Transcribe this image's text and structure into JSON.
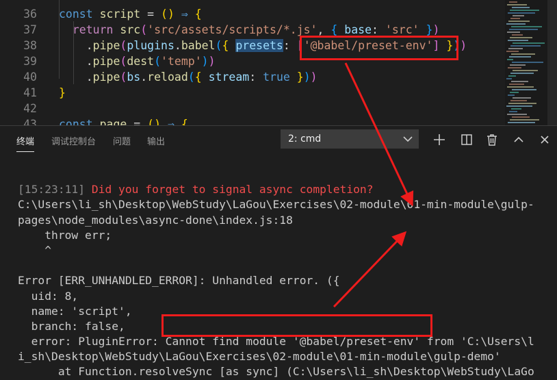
{
  "editor": {
    "lines": [
      {
        "num": "36",
        "tokens": [
          [
            "k-blue",
            "const"
          ],
          [
            "",
            " "
          ],
          [
            "k-fn",
            "script"
          ],
          [
            "",
            " = "
          ],
          [
            "k-gold",
            "()"
          ],
          [
            "",
            " "
          ],
          [
            "k-blue",
            "⇒"
          ],
          [
            "",
            " "
          ],
          [
            "k-gold",
            "{"
          ]
        ]
      },
      {
        "num": "37",
        "tokens": [
          [
            "",
            "  "
          ],
          [
            "k-purple",
            "return"
          ],
          [
            "",
            " "
          ],
          [
            "k-fn",
            "src"
          ],
          [
            "k-pink",
            "("
          ],
          [
            "k-str",
            "'src/assets/scripts/*.js'"
          ],
          [
            "",
            ", "
          ],
          [
            "k-sky",
            "{"
          ],
          [
            "",
            " "
          ],
          [
            "k-var",
            "base"
          ],
          [
            "",
            ": "
          ],
          [
            "k-str",
            "'src'"
          ],
          [
            "",
            " "
          ],
          [
            "k-sky",
            "}"
          ],
          [
            "k-pink",
            ")"
          ]
        ]
      },
      {
        "num": "38",
        "tokens": [
          [
            "",
            "    ."
          ],
          [
            "k-fn",
            "pipe"
          ],
          [
            "k-pink",
            "("
          ],
          [
            "k-var",
            "plugins"
          ],
          [
            "",
            "."
          ],
          [
            "k-fn",
            "babel"
          ],
          [
            "k-sky",
            "("
          ],
          [
            "k-gold",
            "{"
          ],
          [
            "",
            " "
          ],
          [
            "k-var hl",
            "presets"
          ],
          [
            "",
            ": "
          ],
          [
            "k-pink",
            "["
          ],
          [
            "k-str",
            "'@babel/preset-env'"
          ],
          [
            "k-pink",
            "]"
          ],
          [
            "",
            " "
          ],
          [
            "k-gold",
            "}"
          ],
          [
            "k-sky",
            ")"
          ],
          [
            "k-pink",
            ")"
          ]
        ]
      },
      {
        "num": "39",
        "tokens": [
          [
            "",
            "    ."
          ],
          [
            "k-fn",
            "pipe"
          ],
          [
            "k-pink",
            "("
          ],
          [
            "k-fn",
            "dest"
          ],
          [
            "k-sky",
            "("
          ],
          [
            "k-str",
            "'temp'"
          ],
          [
            "k-sky",
            ")"
          ],
          [
            "k-pink",
            ")"
          ]
        ]
      },
      {
        "num": "40",
        "tokens": [
          [
            "",
            "    ."
          ],
          [
            "k-fn",
            "pipe"
          ],
          [
            "k-pink",
            "("
          ],
          [
            "k-var",
            "bs"
          ],
          [
            "",
            "."
          ],
          [
            "k-fn",
            "reload"
          ],
          [
            "k-sky",
            "("
          ],
          [
            "k-gold",
            "{"
          ],
          [
            "",
            " "
          ],
          [
            "k-var",
            "stream"
          ],
          [
            "",
            ": "
          ],
          [
            "k-blue",
            "true"
          ],
          [
            "",
            " "
          ],
          [
            "k-gold",
            "}"
          ],
          [
            "k-sky",
            ")"
          ],
          [
            "k-pink",
            ")"
          ]
        ]
      },
      {
        "num": "41",
        "tokens": [
          [
            "k-gold",
            "}"
          ]
        ]
      },
      {
        "num": "42",
        "tokens": []
      },
      {
        "num": "43",
        "tokens": [
          [
            "k-blue",
            "const"
          ],
          [
            "",
            " "
          ],
          [
            "k-fn",
            "page"
          ],
          [
            "",
            " = "
          ],
          [
            "k-gold",
            "()"
          ],
          [
            "",
            " "
          ],
          [
            "k-blue",
            "⇒"
          ],
          [
            "",
            " "
          ],
          [
            "k-gold",
            "{"
          ]
        ]
      }
    ]
  },
  "panel": {
    "tabs": [
      "终端",
      "调试控制台",
      "问题",
      "输出"
    ],
    "active_tab": 0,
    "terminal_select": "2: cmd",
    "terminal_lines": [
      [
        [
          "",
          " "
        ]
      ],
      [
        [
          "gray",
          "[15:23:11]"
        ],
        [
          "",
          " "
        ],
        [
          "red",
          "Did you forget to signal async completion?"
        ]
      ],
      [
        [
          "",
          "C:\\Users\\li_sh\\Desktop\\WebStudy\\LaGou\\Exercises\\02-module\\01-min-module\\gulp-"
        ]
      ],
      [
        [
          "",
          "pages\\node_modules\\async-done\\index.js:18"
        ]
      ],
      [
        [
          "",
          "    throw err;"
        ]
      ],
      [
        [
          "",
          "    ^"
        ]
      ],
      [
        [
          "",
          " "
        ]
      ],
      [
        [
          "",
          "Error [ERR_UNHANDLED_ERROR]: Unhandled error. ({"
        ]
      ],
      [
        [
          "",
          "  uid: 8,"
        ]
      ],
      [
        [
          "",
          "  name: 'script',"
        ]
      ],
      [
        [
          "",
          "  branch: false,"
        ]
      ],
      [
        [
          "",
          "  error: PluginError: Cannot find module '@babel/preset-env' from 'C:\\Users\\l"
        ]
      ],
      [
        [
          "",
          "i_sh\\Desktop\\WebStudy\\LaGou\\Exercises\\02-module\\01-min-module\\gulp-demo'"
        ]
      ],
      [
        [
          "",
          "      at Function.resolveSync [as sync] (C:\\Users\\li_sh\\Desktop\\WebStudy\\LaGo"
        ]
      ]
    ]
  },
  "annotation": {
    "color": "#ee1c1c"
  }
}
